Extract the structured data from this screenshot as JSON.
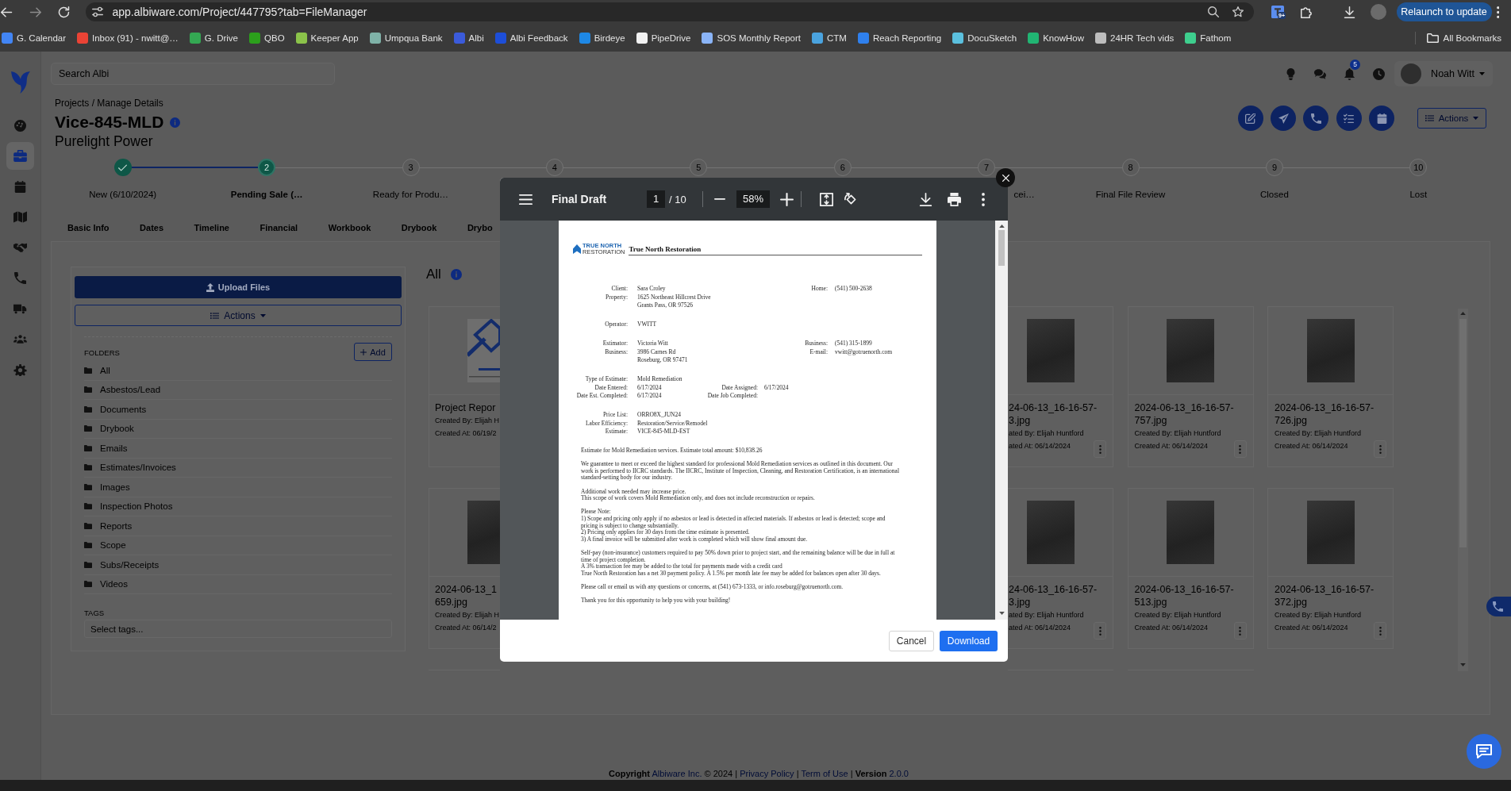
{
  "browser": {
    "url": "app.albiware.com/Project/447795?tab=FileManager",
    "extension_badge": "9+",
    "relaunch_label": "Relaunch to update",
    "bookmarks": [
      {
        "label": "G. Calendar",
        "color": "#4285f4"
      },
      {
        "label": "Inbox (91) - nwitt@…",
        "color": "#ea4335"
      },
      {
        "label": "G. Drive",
        "color": "#34a853"
      },
      {
        "label": "QBO",
        "color": "#2ca01c"
      },
      {
        "label": "Keeper App",
        "color": "#8bc34a"
      },
      {
        "label": "Umpqua Bank",
        "color": "#7fb2a8"
      },
      {
        "label": "Albi",
        "color": "#3b5bdb"
      },
      {
        "label": "Albi Feedback",
        "color": "#1d4ed8"
      },
      {
        "label": "Birdeye",
        "color": "#1e88e5"
      },
      {
        "label": "PipeDrive",
        "color": "#f2f2f2"
      },
      {
        "label": "SOS Monthly Report",
        "color": "#8ab4f8"
      },
      {
        "label": "CTM",
        "color": "#4aa3df"
      },
      {
        "label": "Reach Reporting",
        "color": "#2f80ed"
      },
      {
        "label": "DocuSketch",
        "color": "#5bc0de"
      },
      {
        "label": "KnowHow",
        "color": "#21b573"
      },
      {
        "label": "24HR Tech vids",
        "color": "#bdbdbd"
      },
      {
        "label": "Fathom",
        "color": "#3ecf8e"
      }
    ],
    "all_bookmarks": "All Bookmarks"
  },
  "nav": {
    "items": [
      {
        "selected": false
      },
      {
        "selected": true
      },
      {
        "selected": false
      },
      {
        "selected": false
      },
      {
        "selected": false
      },
      {
        "selected": false
      },
      {
        "selected": false
      },
      {
        "selected": false
      },
      {
        "selected": false
      }
    ]
  },
  "header": {
    "search_placeholder": "Search Albi",
    "notification_count": "5",
    "user_name": "Noah Witt"
  },
  "project": {
    "breadcrumb": "Projects / Manage Details",
    "title": "Vice-845-MLD",
    "subtitle": "Purelight Power",
    "actions_label": "Actions"
  },
  "stages": [
    {
      "completed": true,
      "current": false,
      "label": "New (6/10/2024)"
    },
    {
      "number": "2",
      "completed": false,
      "current": true,
      "label": "Pending Sale (…"
    },
    {
      "number": "3",
      "completed": false,
      "current": false,
      "label": "Ready for Produ…"
    },
    {
      "number": "4",
      "completed": false,
      "current": false
    },
    {
      "number": "5",
      "completed": false,
      "current": false
    },
    {
      "number": "6",
      "completed": false,
      "current": false
    },
    {
      "number": "7",
      "completed": false,
      "current": false,
      "label": "cei…"
    },
    {
      "number": "8",
      "completed": false,
      "current": false,
      "label": "Final File Review"
    },
    {
      "number": "9",
      "completed": false,
      "current": false,
      "label": "Closed"
    },
    {
      "number": "10",
      "completed": false,
      "current": false,
      "label": "Lost"
    }
  ],
  "tabs": [
    {
      "label": "Basic Info",
      "selected": false
    },
    {
      "label": "Dates",
      "selected": false
    },
    {
      "label": "Timeline",
      "selected": false
    },
    {
      "label": "Financial",
      "selected": false
    },
    {
      "label": "Workbook",
      "selected": false
    },
    {
      "label": "Drybook",
      "selected": false
    },
    {
      "label": "Drybo",
      "selected": false
    }
  ],
  "files_panel": {
    "upload_label": "Upload Files",
    "actions_label": "Actions",
    "folders_heading": "FOLDERS",
    "add_label": "Add",
    "folders": [
      "All",
      "Asbestos/Lead",
      "Documents",
      "Drybook",
      "Emails",
      "Estimates/Invoices",
      "Images",
      "Inspection Photos",
      "Reports",
      "Scope",
      "Subs/Receipts",
      "Videos"
    ],
    "tags_heading": "TAGS",
    "tags_placeholder": "Select tags..."
  },
  "files": {
    "heading": "All",
    "rows": [
      [
        {
          "kind": "start",
          "thumbnail": {
            "kind": "report"
          },
          "name_lines": [
            "Project Repor"
          ],
          "created_by": "Created By: Elijah H",
          "created_at": "Created At: 06/19/2"
        },
        {
          "kind": "end",
          "thumbnail": {
            "kind": "photo"
          },
          "name_lines": [
            "24-06-13_16-16-57-",
            "3.jpg"
          ],
          "created_by": "ated By: Elijah Huntford",
          "created_at": "ated At: 06/14/2024"
        },
        {
          "kind": "full",
          "thumbnail": {
            "kind": "photo"
          },
          "name_lines": [
            "2024-06-13_16-16-57-",
            "757.jpg"
          ],
          "created_by": "Created By: Elijah Huntford",
          "created_at": "Created At: 06/14/2024"
        },
        {
          "kind": "full",
          "thumbnail": {
            "kind": "photo"
          },
          "name_lines": [
            "2024-06-13_16-16-57-",
            "726.jpg"
          ],
          "created_by": "Created By: Elijah Huntford",
          "created_at": "Created At: 06/14/2024"
        }
      ],
      [
        {
          "kind": "start",
          "thumbnail": {
            "kind": "photo"
          },
          "name_lines": [
            "2024-06-13_1",
            "659.jpg"
          ],
          "created_by": "Created By: Elijah H",
          "created_at": "Created At: 06/14/2"
        },
        {
          "kind": "end",
          "thumbnail": {
            "kind": "photo"
          },
          "name_lines": [
            "24-06-13_16-16-57-",
            "3.jpg"
          ],
          "created_by": "ated By: Elijah Huntford",
          "created_at": "ated At: 06/14/2024"
        },
        {
          "kind": "full",
          "thumbnail": {
            "kind": "photo"
          },
          "name_lines": [
            "2024-06-13_16-16-57-",
            "513.jpg"
          ],
          "created_by": "Created By: Elijah Huntford",
          "created_at": "Created At: 06/14/2024"
        },
        {
          "kind": "full",
          "thumbnail": {
            "kind": "photo"
          },
          "name_lines": [
            "2024-06-13_16-16-57-",
            "372.jpg"
          ],
          "created_by": "Created By: Elijah Huntford",
          "created_at": "Created At: 06/14/2024"
        }
      ]
    ]
  },
  "viewer": {
    "title": "Final Draft",
    "page": "1",
    "page_total": "/ 10",
    "zoom": "58%",
    "cancel_label": "Cancel",
    "download_label": "Download"
  },
  "document": {
    "logo_name": "TRUE NORTH",
    "logo_tagline": "RESTORATION",
    "company": "True North Restoration",
    "field_groups": [
      [
        {
          "label": "Client:",
          "value": [
            "Sara Croley"
          ],
          "right": {
            "label": "Home:",
            "value": "(541) 500-2638"
          }
        },
        {
          "label": "Property:",
          "value": [
            "1625 Northeast Hillcrest Drive",
            "Grants Pass, OR 97526"
          ]
        }
      ],
      [
        {
          "label": "Operator:",
          "value": [
            "VWITT"
          ]
        }
      ],
      [
        {
          "label": "Estimator:",
          "value": [
            "Victoria Witt"
          ],
          "right": {
            "label": "Business:",
            "value": "(541) 315-1899"
          }
        },
        {
          "label": "Business:",
          "value": [
            "3986 Carnes Rd",
            "Roseburg, OR 97471"
          ],
          "right": {
            "label": "E-mail:",
            "value": "vwitt@gotruenorth.com"
          }
        }
      ],
      [
        {
          "label": "Type of Estimate:",
          "value": [
            "Mold Remediation"
          ]
        },
        {
          "label": "Date Entered:",
          "value": [
            "6/17/2024"
          ],
          "middle": {
            "label": "Date Assigned:",
            "value": "6/17/2024"
          }
        },
        {
          "label": "Date Est. Completed:",
          "value": [
            "6/17/2024"
          ],
          "middle": {
            "label": "Date Job Completed:"
          }
        }
      ],
      [
        {
          "label": "Price List:",
          "value": [
            "ORRO8X_JUN24"
          ]
        },
        {
          "label": "Labor Efficiency:",
          "value": [
            "Restoration/Service/Remodel"
          ]
        },
        {
          "label": "Estimate:",
          "value": [
            "VICE-845-MLD-EST"
          ]
        }
      ]
    ],
    "paragraphs": [
      [
        "Estimate for Mold Remediation services. Estimate total amount: $10,838.26"
      ],
      [
        "We guarantee to meet or exceed the highest standard for professional Mold Remediation services as outlined in this document. Our work is performed to IICRC standards. The IICRC, Institute of Inspection, Cleaning, and Restoration Certification, is an international standard-setting body for our industry."
      ],
      [
        "Additional work needed may increase price.",
        "This scope of work covers Mold Remediation only, and does not include reconstruction or repairs."
      ],
      [
        "Please Note:",
        "1) Scope and pricing only apply if no asbestos or lead is detected in affected materials. If asbestos or lead is detected; scope and pricing is subject to change substantially.",
        "2) Pricing only applies for 30 days from the time estimate is presented.",
        "3) A final invoice will be submitted after work is completed which will show final amount due."
      ],
      [
        "Self-pay (non-insurance) customers required to pay 50% down prior to project start, and the remaining balance will be due in full at time of project completion.",
        "A 3% transaction fee may be added to the total for payments made with a credit card",
        "True North Restoration has a net 30 payment policy. A 1.5% per month late fee may be added for balances open after 30 days."
      ],
      [
        "Please call or email us with any questions or concerns, at (541) 673-1333, or info.roseburg@gotruenorth.com."
      ],
      [
        "Thank you for this opportunity to help you with your building!"
      ]
    ]
  },
  "footer": {
    "parts": [
      {
        "kind": "bold",
        "text": "Copyright"
      },
      {
        "kind": "link",
        "text": "Albiware Inc."
      },
      {
        "kind": "text",
        "text": "© 2024 |"
      },
      {
        "kind": "link",
        "text": "Privacy Policy"
      },
      {
        "kind": "text",
        "text": "|"
      },
      {
        "kind": "link",
        "text": "Term of Use"
      },
      {
        "kind": "text",
        "text": "|"
      },
      {
        "kind": "bold",
        "text": "Version"
      },
      {
        "kind": "link",
        "text": "2.0.0"
      }
    ]
  }
}
